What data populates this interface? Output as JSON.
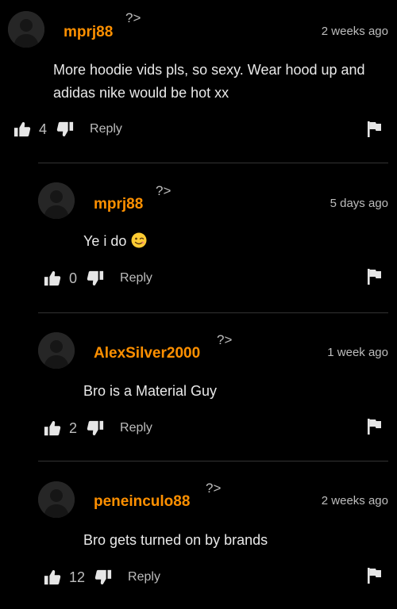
{
  "comments": [
    {
      "username": "mprj88",
      "time": "2 weeks ago",
      "qmark": "?>",
      "body": "More hoodie vids pls, so sexy. Wear hood up and adidas nike would be hot xx",
      "likes": "4",
      "reply": "Reply"
    },
    {
      "username": "mprj88",
      "time": "5 days ago",
      "qmark": "?>",
      "body": "Ye i do",
      "emoji": "winking-face",
      "likes": "0",
      "reply": "Reply"
    },
    {
      "username": "AlexSilver2000",
      "time": "1 week ago",
      "qmark": "?>",
      "body": "Bro is a Material Guy",
      "likes": "2",
      "reply": "Reply"
    },
    {
      "username": "peneinculo88",
      "time": "2 weeks ago",
      "qmark": "?>",
      "body": "Bro gets turned on by brands",
      "likes": "12",
      "reply": "Reply"
    }
  ],
  "colors": {
    "username": "#ff9000",
    "background": "#000000",
    "muted": "#bdbdbd"
  }
}
